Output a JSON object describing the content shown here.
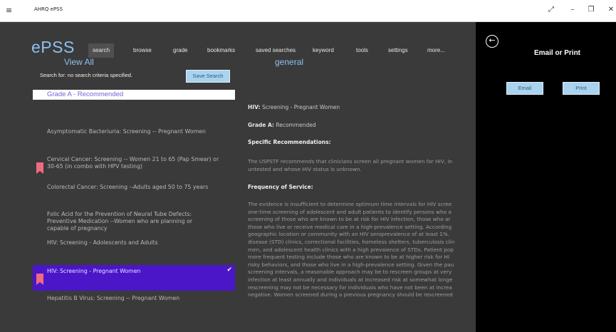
{
  "titlebar": {
    "app_title": "AHRQ ePSS",
    "menu_icon": "hamburger-icon",
    "controls": [
      "⤢",
      "–",
      "❐",
      "✕"
    ]
  },
  "app": {
    "brand": "ePSS",
    "nav": [
      "search",
      "browse",
      "grade",
      "bookmarks",
      "saved searches",
      "keyword",
      "tools",
      "settings",
      "more..."
    ],
    "active_nav": "search"
  },
  "left": {
    "view_all": "View All",
    "search_for": "Search for: no search criteria specified.",
    "save_search": "Save Search",
    "grade_header": "Grade A - Recommended",
    "items": [
      {
        "lines": [
          "Asymptomatic Bacteriuria: Screening -- Pregnant Women"
        ],
        "bookmarked": false,
        "selected": false
      },
      {
        "lines": [
          "Cervical Cancer: Screening -- Women 21 to 65 (Pap Smear) or",
          "30-65 (in combo with HPV testing)"
        ],
        "bookmarked": true,
        "selected": false
      },
      {
        "lines": [
          "Colorectal Cancer: Screening --Adults aged 50 to 75 years"
        ],
        "bookmarked": false,
        "selected": false
      },
      {
        "lines": [
          "Folic Acid for the Prevention of Neural Tube Defects:",
          "Preventive Medication --Women who are planning or",
          "capable of pregnancy"
        ],
        "bookmarked": false,
        "selected": false
      },
      {
        "lines": [
          "HIV: Screening - Adolescents and Adults"
        ],
        "bookmarked": false,
        "selected": false
      },
      {
        "lines": [
          "HIV: Screening - Pregnant Women"
        ],
        "bookmarked": true,
        "selected": true
      },
      {
        "lines": [
          "Hepatitis B Virus: Screening -- Pregnant Women"
        ],
        "bookmarked": false,
        "selected": false
      }
    ]
  },
  "content": {
    "title": "general",
    "topic_label": "HIV:",
    "topic_value": "Screening - Pregnant Women",
    "grade_label": "Grade A:",
    "grade_value": "Recommended",
    "specific_heading": "Specific Recommendations:",
    "specific_lines": [
      "The USPSTF recommends that clinicians screen all pregnant women for HIV, in",
      "untested and whose HIV status is unknown."
    ],
    "frequency_heading": "Frequency of Service:",
    "frequency_lines": [
      "The evidence is insufficient to determine optimum time intervals for HIV scree",
      "one-time screening of adolescent and adult patients to identify persons who a",
      "screening of those who are known to be at risk for HIV infection, those who ar",
      "those who live or receive medical care in a high-prevalence setting. According",
      "geographic location or community with an HIV seroprevalence of at least 1%.",
      "disease (STD) clinics, correctional facilities, homeless shelters, tuberculosis clin",
      "men, and adolescent health clinics with a high prevalence of STDs. Patient pop",
      "more frequent testing include those who are known to be at higher risk for HI",
      "risky behaviors, and those who live in a high-prevalence setting. Given the pau",
      "screening intervals, a reasonable approach may be to rescreen groups at very",
      "infection at least annually and individuals at increased risk at somewhat longe",
      "rescreening may not be necessary for individuals who have not been at increa",
      "negative. Women screened during a previous pregnancy should be rescreened"
    ]
  },
  "flyout": {
    "back_icon": "back-arrow-icon",
    "title": "Email or Print",
    "email": "Email",
    "print": "Print"
  },
  "colors": {
    "accent_blue": "#8fc0ee",
    "button_blue": "#a9d3ee",
    "selection_purple": "#4a16c8",
    "bookmark_pink": "#f06a82"
  }
}
